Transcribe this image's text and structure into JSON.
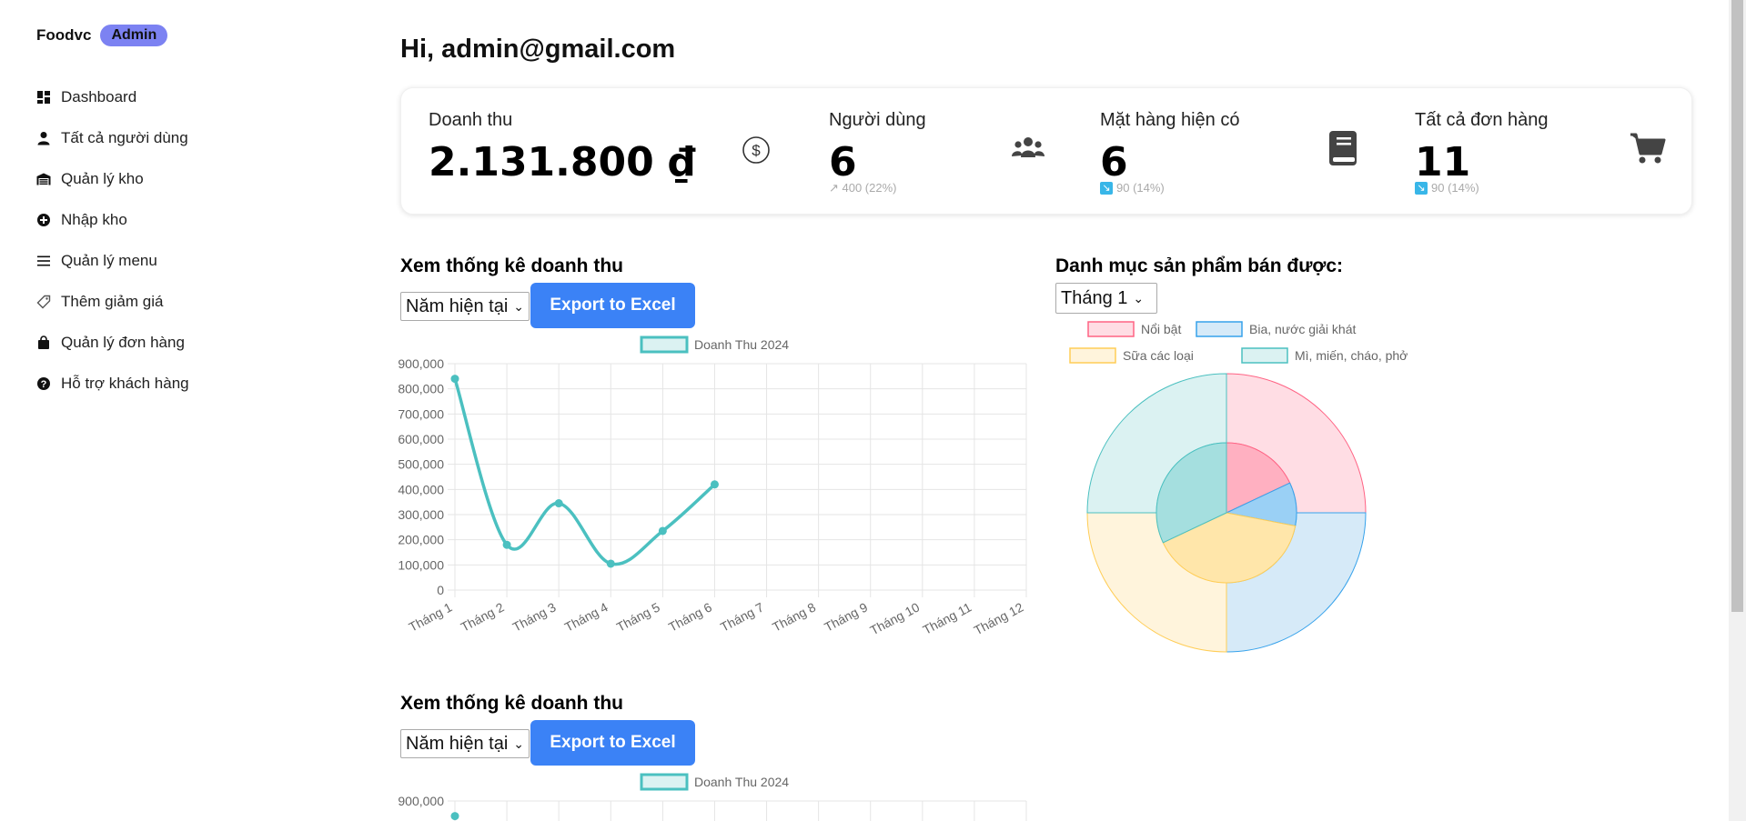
{
  "brand": {
    "name": "Foodvc",
    "badge": "Admin"
  },
  "nav": [
    {
      "label": "Dashboard",
      "icon": "dashboard-icon"
    },
    {
      "label": "Tất cả người dùng",
      "icon": "user-icon"
    },
    {
      "label": "Quản lý kho",
      "icon": "warehouse-icon"
    },
    {
      "label": "Nhập kho",
      "icon": "plus-circle-icon"
    },
    {
      "label": "Quản lý menu",
      "icon": "menu-icon"
    },
    {
      "label": "Thêm giảm giá",
      "icon": "tag-icon"
    },
    {
      "label": "Quản lý đơn hàng",
      "icon": "shopping-bag-icon"
    },
    {
      "label": "Hỗ trợ khách hàng",
      "icon": "question-circle-icon"
    }
  ],
  "greeting": "Hi, admin@gmail.com",
  "stats": {
    "revenue": {
      "label": "Doanh thu",
      "value": "2.131.800 ₫",
      "icon": "dollar-circle-icon"
    },
    "users": {
      "label": "Người dùng",
      "value": "6",
      "delta": "↗ 400 (22%)",
      "icon": "users-icon"
    },
    "products": {
      "label": "Mặt hàng hiện có",
      "value": "6",
      "delta": "90 (14%)",
      "delta_icon": "↘",
      "icon": "book-icon"
    },
    "orders": {
      "label": "Tất cả đơn hàng",
      "value": "11",
      "delta": "90 (14%)",
      "delta_icon": "↘",
      "icon": "cart-icon"
    }
  },
  "revenue_section": {
    "title": "Xem thống kê doanh thu",
    "select_value": "Năm hiện tại",
    "export_label": "Export to Excel"
  },
  "category_section": {
    "title": "Danh mục sản phẩm bán được:",
    "select_value": "Tháng 1"
  },
  "colors": {
    "accent": "#3b82f6",
    "badge": "#7c82f2",
    "line": "#4bc0c0"
  },
  "chart_data": [
    {
      "type": "line",
      "legend": "Doanh Thu 2024",
      "categories": [
        "Tháng 1",
        "Tháng 2",
        "Tháng 3",
        "Tháng 4",
        "Tháng 5",
        "Tháng 6",
        "Tháng 7",
        "Tháng 8",
        "Tháng 9",
        "Tháng 10",
        "Tháng 11",
        "Tháng 12"
      ],
      "series": [
        {
          "name": "Doanh Thu 2024",
          "values": [
            840000,
            180000,
            345000,
            105000,
            235000,
            420000
          ]
        }
      ],
      "ylim": [
        0,
        900000
      ],
      "yticks": [
        "900,000",
        "800,000",
        "700,000",
        "600,000",
        "500,000",
        "400,000",
        "300,000",
        "200,000",
        "100,000",
        "0"
      ],
      "grid": true,
      "legend_position": "top"
    },
    {
      "type": "pie",
      "legend": [
        {
          "label": "Nổi bật",
          "color": "#ff6384",
          "fill": "#ffdde4"
        },
        {
          "label": "Bia, nước giải khát",
          "color": "#36a2eb",
          "fill": "#d6eaf8"
        },
        {
          "label": "Sữa các loại",
          "color": "#ffcd56",
          "fill": "#fff4dc"
        },
        {
          "label": "Mì, miến, cháo, phở",
          "color": "#4bc0c0",
          "fill": "#dbf2f2"
        }
      ],
      "outer_ring": [
        25,
        25,
        25,
        25
      ],
      "inner_ring": [
        18,
        10,
        40,
        32
      ],
      "legend_position": "top"
    },
    {
      "type": "line",
      "legend": "Doanh Thu 2024",
      "series": [
        {
          "name": "Doanh Thu 2024",
          "values": [
            840000
          ]
        }
      ],
      "ylim": [
        0,
        900000
      ],
      "yticks": [
        "900,000"
      ],
      "grid": true
    }
  ]
}
